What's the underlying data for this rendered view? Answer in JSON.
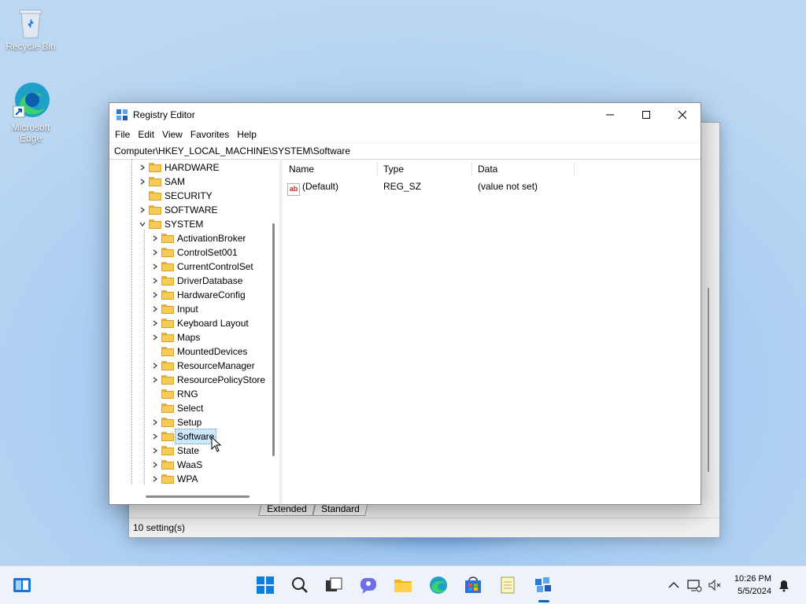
{
  "desktop": {
    "icons": [
      {
        "label": "Recycle Bin",
        "icon": "recycle-bin-icon"
      },
      {
        "label": "Microsoft Edge",
        "icon": "edge-icon"
      }
    ]
  },
  "background_window": {
    "tabs": [
      "Extended",
      "Standard"
    ],
    "status": "10 setting(s)"
  },
  "window": {
    "title": "Registry Editor",
    "menu": [
      "File",
      "Edit",
      "View",
      "Favorites",
      "Help"
    ],
    "address": "Computer\\HKEY_LOCAL_MACHINE\\SYSTEM\\Software",
    "tree": [
      {
        "label": "HARDWARE",
        "expandable": true
      },
      {
        "label": "SAM",
        "expandable": true
      },
      {
        "label": "SECURITY",
        "expandable": false
      },
      {
        "label": "SOFTWARE",
        "expandable": true
      },
      {
        "label": "SYSTEM",
        "expanded": true
      },
      {
        "label": "ActivationBroker",
        "expandable": true
      },
      {
        "label": "ControlSet001",
        "expandable": true
      },
      {
        "label": "CurrentControlSet",
        "expandable": true
      },
      {
        "label": "DriverDatabase",
        "expandable": true
      },
      {
        "label": "HardwareConfig",
        "expandable": true
      },
      {
        "label": "Input",
        "expandable": true
      },
      {
        "label": "Keyboard Layout",
        "expandable": true
      },
      {
        "label": "Maps",
        "expandable": true
      },
      {
        "label": "MountedDevices",
        "expandable": false
      },
      {
        "label": "ResourceManager",
        "expandable": true
      },
      {
        "label": "ResourcePolicyStore",
        "expandable": true
      },
      {
        "label": "RNG",
        "expandable": false
      },
      {
        "label": "Select",
        "expandable": false
      },
      {
        "label": "Setup",
        "expandable": true
      },
      {
        "label": "Software",
        "expandable": true,
        "selected": true
      },
      {
        "label": "State",
        "expandable": true
      },
      {
        "label": "WaaS",
        "expandable": true
      },
      {
        "label": "WPA",
        "expandable": true
      }
    ],
    "columns": [
      "Name",
      "Type",
      "Data"
    ],
    "values": [
      {
        "name": "(Default)",
        "type": "REG_SZ",
        "data": "(value not set)",
        "icon": "string-value-icon"
      }
    ]
  },
  "taskbar": {
    "apps": [
      "start-icon",
      "search-icon",
      "task-view-icon",
      "chat-icon",
      "file-explorer-icon",
      "edge-icon",
      "store-icon",
      "notepad-icon",
      "registry-editor-icon"
    ],
    "time": "10:26 PM",
    "date": "5/5/2024"
  },
  "colors": {
    "selection": "#cce8ff",
    "folder": "#f6cc55",
    "accent": "#0067c0"
  }
}
